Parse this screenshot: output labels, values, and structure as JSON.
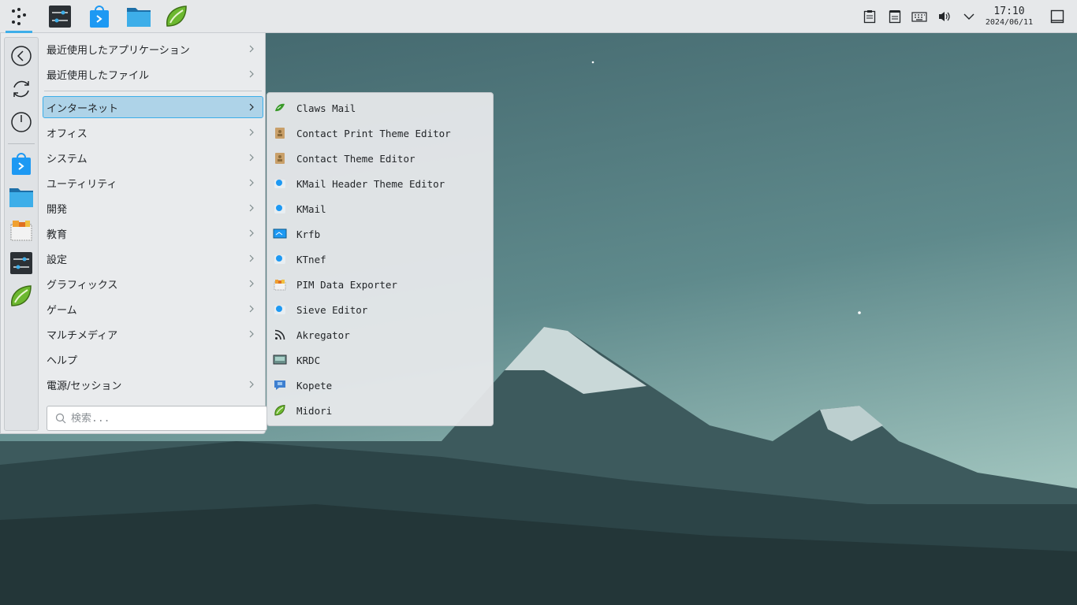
{
  "panel": {
    "launchers": [
      {
        "name": "application-launcher",
        "icon": "kde-launcher-icon"
      },
      {
        "name": "system-settings",
        "icon": "settings-sliders-icon"
      },
      {
        "name": "discover",
        "icon": "store-bag-icon"
      },
      {
        "name": "file-manager",
        "icon": "folder-icon"
      },
      {
        "name": "midori",
        "icon": "midori-leaf-icon"
      }
    ],
    "tray": [
      "clipboard-icon",
      "notes-icon",
      "keyboard-icon",
      "volume-icon",
      "chevron-down-icon"
    ],
    "clock": {
      "time": "17:10",
      "date": "2024/06/11"
    },
    "show_desktop_icon": "show-desktop-icon"
  },
  "menu": {
    "favorites": [
      {
        "name": "back",
        "icon": "back-arrow-icon"
      },
      {
        "name": "restart",
        "icon": "refresh-icon"
      },
      {
        "name": "shutdown",
        "icon": "power-icon"
      },
      {
        "name": "discover",
        "icon": "store-bag-icon"
      },
      {
        "name": "file-manager",
        "icon": "folder-icon"
      },
      {
        "name": "pim-data",
        "icon": "pim-archive-icon"
      },
      {
        "name": "system-settings",
        "icon": "settings-sliders-icon"
      },
      {
        "name": "midori",
        "icon": "midori-leaf-icon"
      }
    ],
    "categories": [
      {
        "label": "最近使用したアプリケーション",
        "has_submenu": true
      },
      {
        "label": "最近使用したファイル",
        "has_submenu": true
      },
      {
        "label": "インターネット",
        "has_submenu": true,
        "highlighted": true
      },
      {
        "label": "オフィス",
        "has_submenu": true
      },
      {
        "label": "システム",
        "has_submenu": true
      },
      {
        "label": "ユーティリティ",
        "has_submenu": true
      },
      {
        "label": "開発",
        "has_submenu": true
      },
      {
        "label": "教育",
        "has_submenu": true
      },
      {
        "label": "設定",
        "has_submenu": true
      },
      {
        "label": "グラフィックス",
        "has_submenu": true
      },
      {
        "label": "ゲーム",
        "has_submenu": true
      },
      {
        "label": "マルチメディア",
        "has_submenu": true
      },
      {
        "label": "ヘルプ",
        "has_submenu": false
      },
      {
        "label": "電源/セッション",
        "has_submenu": true
      }
    ],
    "search": {
      "placeholder": "検索..."
    }
  },
  "submenu": {
    "items": [
      {
        "label": "Claws Mail",
        "icon": "claws-mail-icon"
      },
      {
        "label": "Contact Print Theme Editor",
        "icon": "contact-theme-icon"
      },
      {
        "label": "Contact Theme Editor",
        "icon": "contact-theme-icon"
      },
      {
        "label": "KMail Header Theme Editor",
        "icon": "kmail-icon"
      },
      {
        "label": "KMail",
        "icon": "kmail-icon"
      },
      {
        "label": "Krfb",
        "icon": "remote-desktop-icon"
      },
      {
        "label": "KTnef",
        "icon": "kmail-icon"
      },
      {
        "label": "PIM Data Exporter",
        "icon": "pim-archive-icon"
      },
      {
        "label": "Sieve Editor",
        "icon": "kmail-icon"
      },
      {
        "label": "Akregator",
        "icon": "rss-feed-icon"
      },
      {
        "label": "KRDC",
        "icon": "remote-desktop-client-icon"
      },
      {
        "label": "Kopete",
        "icon": "chat-icon"
      },
      {
        "label": "Midori",
        "icon": "midori-leaf-icon"
      }
    ]
  },
  "colors": {
    "accent": "#3daee9",
    "highlight": "#aed3e8",
    "panel": "#e6e8ea"
  }
}
